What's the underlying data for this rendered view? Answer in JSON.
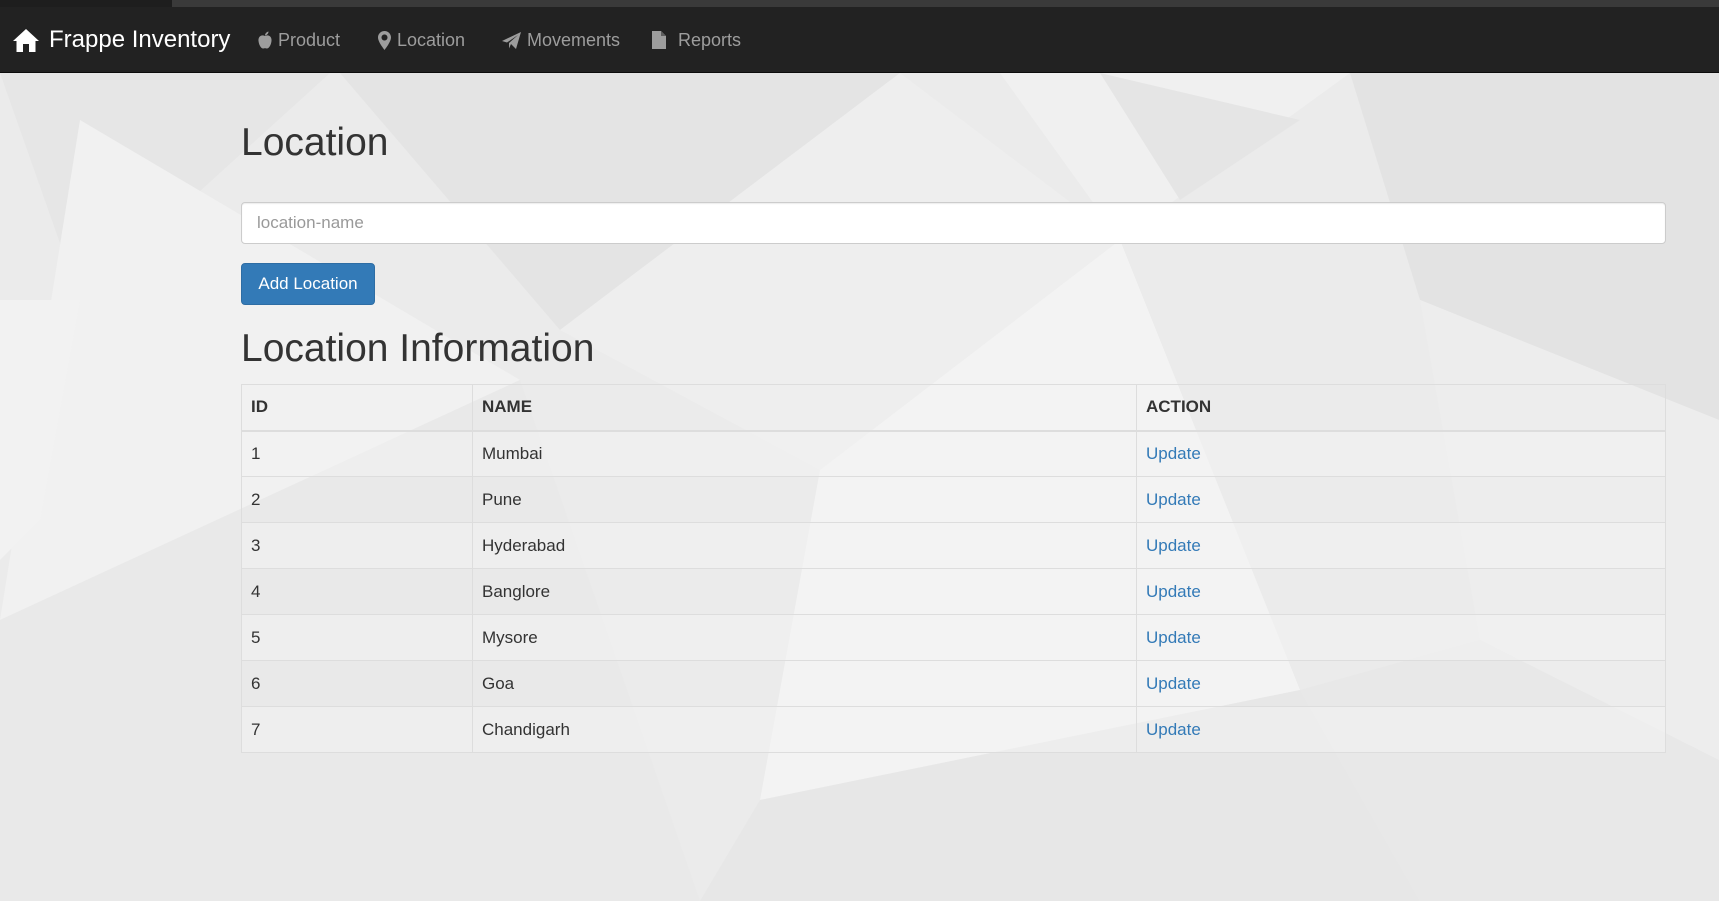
{
  "app": {
    "brand": "Frappe Inventory"
  },
  "nav": [
    {
      "label": "Product",
      "icon": "apple-icon"
    },
    {
      "label": "Location",
      "icon": "map-marker-icon"
    },
    {
      "label": "Movements",
      "icon": "send-icon"
    },
    {
      "label": "Reports",
      "icon": "file-icon"
    }
  ],
  "page": {
    "title": "Location",
    "input": {
      "placeholder": "location-name",
      "value": ""
    },
    "add_button": "Add Location",
    "section_title": "Location Information"
  },
  "table": {
    "headers": [
      "ID",
      "NAME",
      "ACTION"
    ],
    "rows": [
      {
        "id": "1",
        "name": "Mumbai",
        "action": "Update"
      },
      {
        "id": "2",
        "name": "Pune",
        "action": "Update"
      },
      {
        "id": "3",
        "name": "Hyderabad",
        "action": "Update"
      },
      {
        "id": "4",
        "name": "Banglore",
        "action": "Update"
      },
      {
        "id": "5",
        "name": "Mysore",
        "action": "Update"
      },
      {
        "id": "6",
        "name": "Goa",
        "action": "Update"
      },
      {
        "id": "7",
        "name": "Chandigarh",
        "action": "Update"
      }
    ]
  },
  "colors": {
    "navbar": "#222222",
    "nav_text": "#9d9d9d",
    "primary": "#337ab7",
    "link": "#337ab7",
    "background": "#ececec"
  }
}
